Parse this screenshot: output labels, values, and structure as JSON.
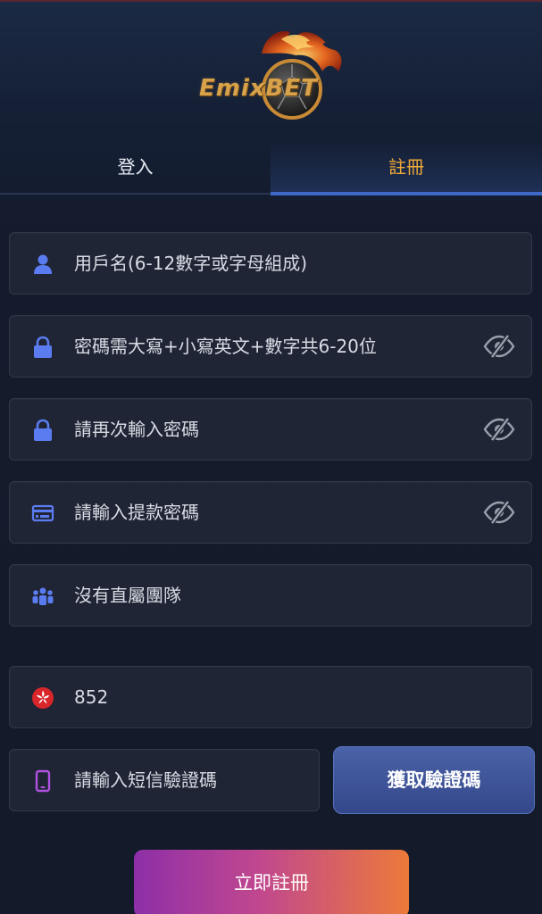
{
  "brand": {
    "logo_text": "EmixBET"
  },
  "tabs": [
    {
      "label": "登入",
      "active": false
    },
    {
      "label": "註冊",
      "active": true
    }
  ],
  "form": {
    "username": {
      "placeholder": "用戶名(6-12數字或字母組成)",
      "icon": "user-icon"
    },
    "password": {
      "placeholder": "密碼需大寫+小寫英文+數字共6-20位",
      "icon": "lock-icon"
    },
    "confirm_password": {
      "placeholder": "請再次輸入密碼",
      "icon": "lock-icon"
    },
    "withdraw_password": {
      "placeholder": "請輸入提款密碼",
      "icon": "card-icon"
    },
    "team": {
      "value": "沒有直屬團隊",
      "icon": "team-icon"
    },
    "phone": {
      "value": "852",
      "icon": "hong-kong-flag-icon"
    },
    "sms_code": {
      "placeholder": "請輸入短信驗證碼",
      "icon": "phone-icon"
    }
  },
  "buttons": {
    "get_code": "獲取驗證碼",
    "register": "立即註冊"
  },
  "colors": {
    "accent_orange": "#f0a93a",
    "accent_blue": "#3e69c9",
    "icon_blue": "#5b7cf0",
    "icon_purple": "#b052e0"
  }
}
